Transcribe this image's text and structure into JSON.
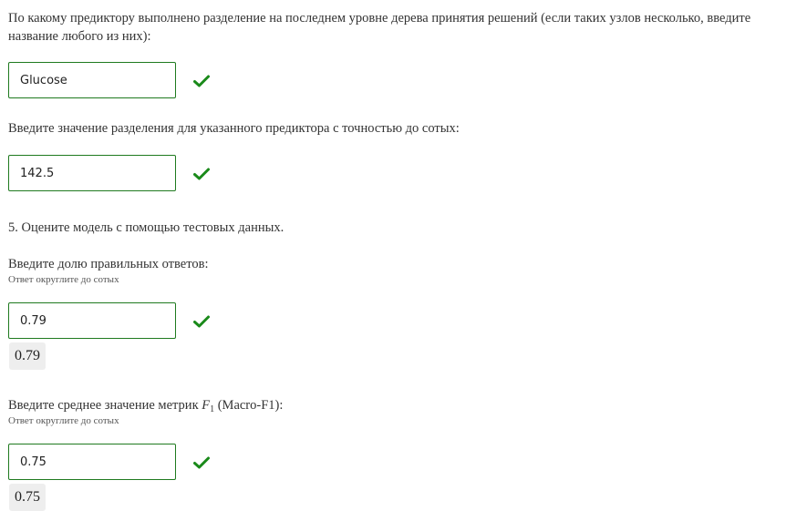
{
  "questions": [
    {
      "prompt": "По какому предиктору выполнено разделение на последнем уровне дерева принятия решений (если таких узлов несколько, введите название любого из них):",
      "answer": "Glucose"
    },
    {
      "prompt": "Введите значение разделения для указанного предиктора с точностью до сотых:",
      "answer": "142.5"
    }
  ],
  "section": {
    "heading": "5. Оцените модель с помощью тестовых данных."
  },
  "accuracy": {
    "prompt": "Введите долю правильных ответов:",
    "hint": "Ответ округлите до сотых",
    "answer": "0.79",
    "preview": "0.79"
  },
  "f1": {
    "prompt_prefix": "Введите среднее значение метрик ",
    "math_symbol": "F",
    "math_subscript": "1",
    "prompt_suffix": " (Macro-F1):",
    "hint": "Ответ округлите до сотых",
    "answer": "0.75",
    "preview": "0.75"
  },
  "colors": {
    "correct_border": "#1f7a1f",
    "check_mark": "#1a8a1a",
    "preview_bg": "#eeeeee"
  },
  "icons": {
    "correct": "checkmark-icon"
  }
}
